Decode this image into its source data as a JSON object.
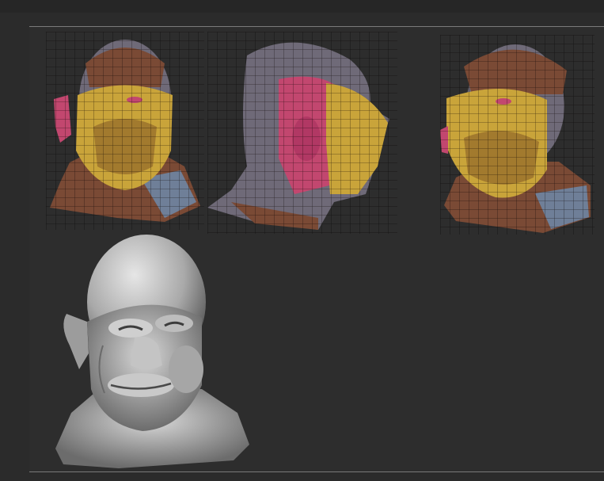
{
  "viewport": {
    "background": "#2d2d2d",
    "rule_color": "#7a7a7a"
  },
  "models": [
    {
      "name": "polypaint-head-front",
      "view": "front",
      "style": "polygroup-wireframe"
    },
    {
      "name": "polypaint-head-side",
      "view": "side",
      "style": "polygroup-wireframe"
    },
    {
      "name": "polypaint-head-three-quarter",
      "view": "three-quarter",
      "style": "polygroup-wireframe"
    },
    {
      "name": "sculpted-head-detailed",
      "view": "three-quarter",
      "style": "matcap-grey"
    }
  ],
  "colors": {
    "skin_yellow": "#c9a43a",
    "skin_brown": "#7a4a35",
    "skin_slate": "#6f7f98",
    "ear_pink": "#c2476f",
    "wire": "#1e1410",
    "clay": "#b8b8b8"
  }
}
